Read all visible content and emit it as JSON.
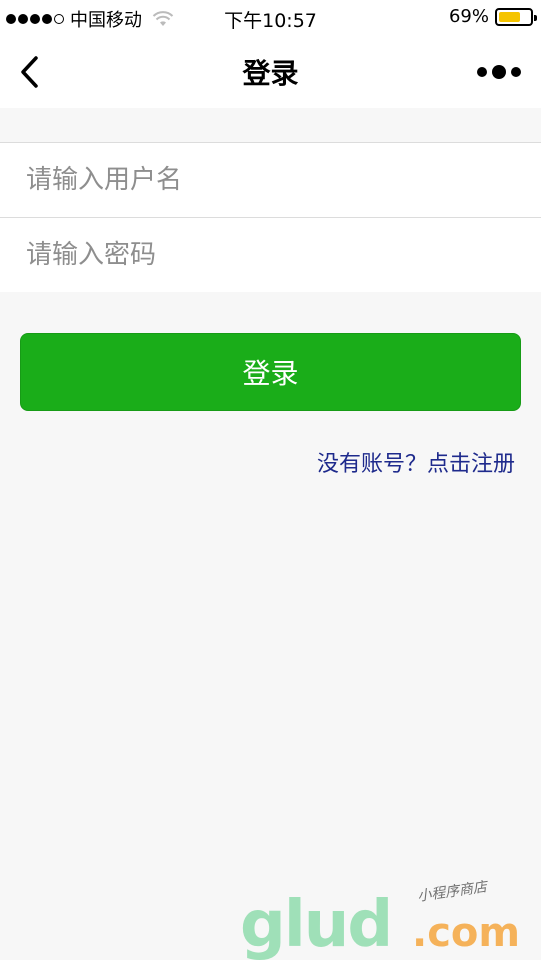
{
  "status_bar": {
    "carrier": "中国移动",
    "time": "下午10:57",
    "battery_percent": "69%",
    "battery_level": 0.69,
    "battery_color": "#f5c400"
  },
  "nav": {
    "title": "登录",
    "back_icon": "chevron-left-icon",
    "more_icon": "more-dots-icon"
  },
  "form": {
    "username_placeholder": "请输入用户名",
    "password_placeholder": "请输入密码"
  },
  "login_button": {
    "label": "登录",
    "color": "#1aad19"
  },
  "register_link": {
    "label": "没有账号？点击注册"
  },
  "watermark": {
    "main": "glud",
    "dotcom": ".com",
    "sub": "小程序商店"
  }
}
